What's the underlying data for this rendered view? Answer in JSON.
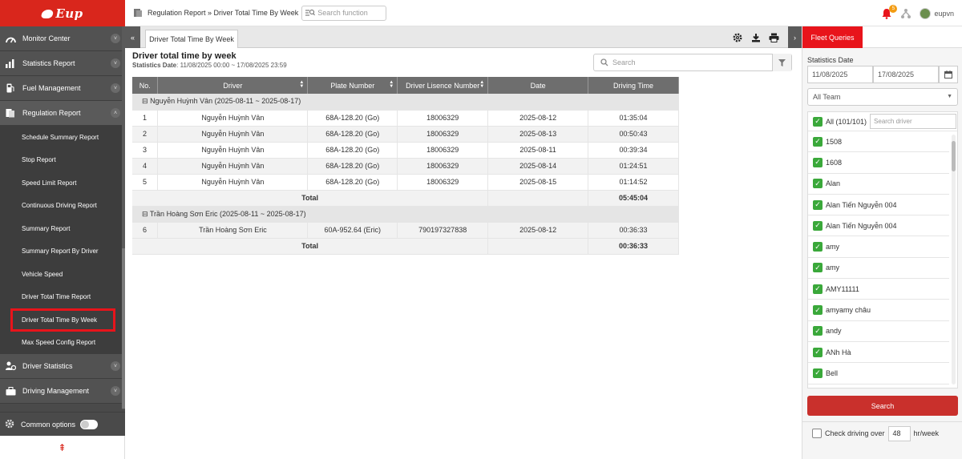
{
  "app": {
    "logo_text": "Eup"
  },
  "header": {
    "breadcrumb": "Regulation Report » Driver Total Time By Week",
    "search_placeholder": "Search function",
    "notification_count": "5",
    "username": "eupvn"
  },
  "sidebar": {
    "items": [
      {
        "label": "Monitor Center",
        "icon": "speedometer-icon"
      },
      {
        "label": "Statistics Report",
        "icon": "bar-chart-icon"
      },
      {
        "label": "Fuel Management",
        "icon": "fuel-pump-icon"
      },
      {
        "label": "Regulation Report",
        "icon": "report-icon"
      }
    ],
    "sub_items": [
      "Schedule Summary Report",
      "Stop Report",
      "Speed Limit Report",
      "Continuous Driving Report",
      "Summary Report",
      "Summary Report By Driver",
      "Vehicle Speed",
      "Driver Total Time Report",
      "Driver Total Time By Week",
      "Max Speed Config Report"
    ],
    "items_after": [
      {
        "label": "Driver Statistics",
        "icon": "driver-icon"
      },
      {
        "label": "Driving Management",
        "icon": "briefcase-icon"
      }
    ],
    "common_options": "Common options",
    "back_to_top": "⇞"
  },
  "tabs": {
    "active": "Driver Total Time By Week",
    "collapse": "«",
    "expand": "›"
  },
  "report": {
    "title": "Driver total time by week",
    "stat_date_label": "Statistics Date",
    "stat_date_value": ": 11/08/2025 00:00 ~ 17/08/2025 23:59",
    "search_placeholder": "Search",
    "columns": [
      "No.",
      "Driver",
      "Plate Number",
      "Driver Lisence Number",
      "Date",
      "Driving Time"
    ],
    "groups": [
      {
        "header": "Nguyễn Huỳnh Vân (2025-08-11 ~ 2025-08-17)",
        "rows": [
          [
            "1",
            "Nguyễn Huỳnh Vân",
            "68A-128.20 (Go)",
            "18006329",
            "2025-08-12",
            "01:35:04"
          ],
          [
            "2",
            "Nguyễn Huỳnh Vân",
            "68A-128.20 (Go)",
            "18006329",
            "2025-08-13",
            "00:50:43"
          ],
          [
            "3",
            "Nguyễn Huỳnh Vân",
            "68A-128.20 (Go)",
            "18006329",
            "2025-08-11",
            "00:39:34"
          ],
          [
            "4",
            "Nguyễn Huỳnh Vân",
            "68A-128.20 (Go)",
            "18006329",
            "2025-08-14",
            "01:24:51"
          ],
          [
            "5",
            "Nguyễn Huỳnh Vân",
            "68A-128.20 (Go)",
            "18006329",
            "2025-08-15",
            "01:14:52"
          ]
        ],
        "total_label": "Total",
        "total": "05:45:04"
      },
      {
        "header": "Trần Hoàng Sơn Eric (2025-08-11 ~ 2025-08-17)",
        "rows": [
          [
            "6",
            "Trần Hoàng Sơn Eric",
            "60A-952.64 (Eric)",
            "790197327838",
            "2025-08-12",
            "00:36:33"
          ]
        ],
        "total_label": "Total",
        "total": "00:36:33"
      }
    ]
  },
  "panel": {
    "tab": "Fleet Queries",
    "stat_date_label": "Statistics Date",
    "date_from": "11/08/2025",
    "date_to": "17/08/2025",
    "team": "All Team",
    "all_label": "All (101/101)",
    "driver_search_placeholder": "Search driver",
    "drivers": [
      "1508",
      "1608",
      "Alan",
      "Alan Tiến Nguyễn 004",
      "Alan Tiến Nguyễn 004",
      "amy",
      "amy",
      "AMY11111",
      "amyamy châu",
      "andy",
      "ANh Hà",
      "Bell"
    ],
    "search_button": "Search",
    "check_over_label": "Check driving over",
    "check_over_value": "48",
    "check_over_unit": "hr/week"
  }
}
